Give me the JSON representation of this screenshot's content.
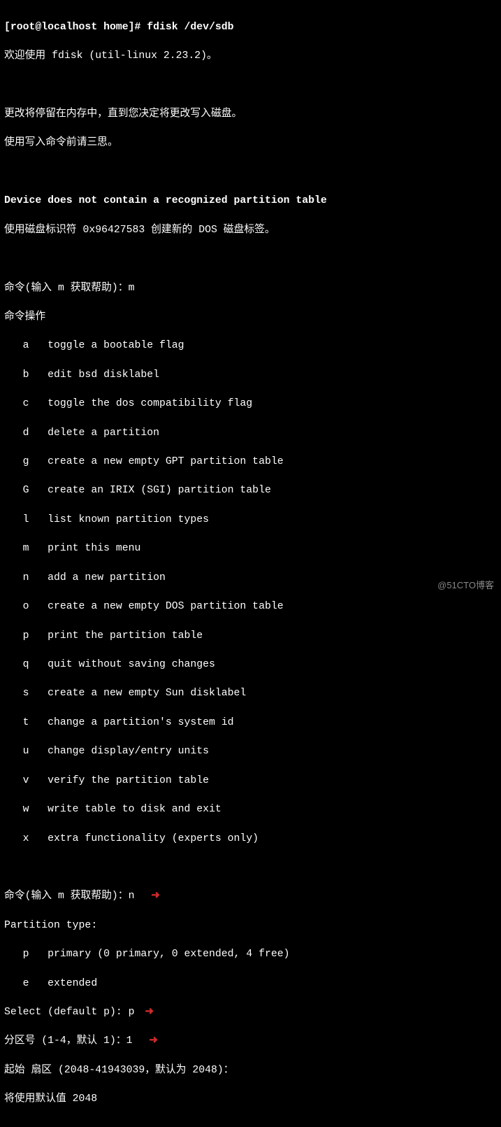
{
  "prompt_line": "[root@localhost home]# fdisk /dev/sdb",
  "welcome": "欢迎使用 fdisk (util-linux 2.23.2)。",
  "notice1": "更改将停留在内存中，直到您决定将更改写入磁盘。",
  "notice2": "使用写入命令前请三思。",
  "no_table": "Device does not contain a recognized partition table",
  "dos_label": "使用磁盘标识符 0x96427583 创建新的 DOS 磁盘标签。",
  "cmd_prompt_m": "命令(输入 m 获取帮助)：m",
  "cmd_header": "命令操作",
  "menu": {
    "a": "   a   toggle a bootable flag",
    "b": "   b   edit bsd disklabel",
    "c": "   c   toggle the dos compatibility flag",
    "d": "   d   delete a partition",
    "g": "   g   create a new empty GPT partition table",
    "G": "   G   create an IRIX (SGI) partition table",
    "l": "   l   list known partition types",
    "m": "   m   print this menu",
    "n": "   n   add a new partition",
    "o": "   o   create a new empty DOS partition table",
    "p": "   p   print the partition table",
    "q": "   q   quit without saving changes",
    "s": "   s   create a new empty Sun disklabel",
    "t": "   t   change a partition's system id",
    "u": "   u   change display/entry units",
    "v": "   v   verify the partition table",
    "w": "   w   write table to disk and exit",
    "x": "   x   extra functionality (experts only)"
  },
  "cmd_prompt_n": "命令(输入 m 获取帮助)：n  ",
  "partition_type_header": "Partition type:",
  "ptype_p": "   p   primary (0 primary, 0 extended, 4 free)",
  "ptype_e": "   e   extended",
  "select_default": "Select (default p): p ",
  "partition_num": "分区号 (1-4，默认 1)：1  ",
  "start_sector": "起始 扇区 (2048-41943039，默认为 2048)：",
  "default_used": "将使用默认值 2048",
  "watermark": "@51CTO博客",
  "arrow": "➜"
}
